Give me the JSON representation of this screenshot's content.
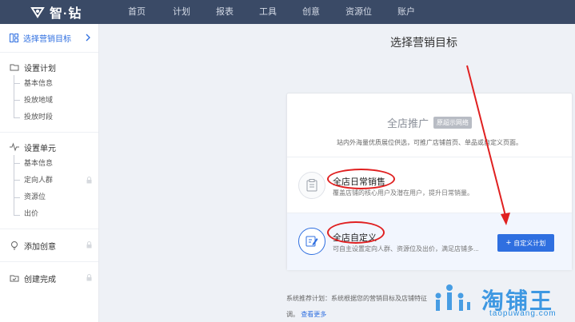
{
  "logo": {
    "text": "智·钻"
  },
  "nav": [
    "首页",
    "计划",
    "报表",
    "工具",
    "创意",
    "资源位",
    "账户"
  ],
  "sidebar": {
    "head": "选择营销目标",
    "plan": {
      "title": "设置计划",
      "items": [
        "基本信息",
        "投放地域",
        "投放时段"
      ]
    },
    "unit": {
      "title": "设置单元",
      "items": [
        "基本信息",
        "定向人群",
        "资源位",
        "出价"
      ]
    },
    "creative": "添加创意",
    "done": "创建完成"
  },
  "main": {
    "title": "选择营销目标",
    "card": {
      "head_title": "全店推广",
      "badge": "原超示网络",
      "head_desc": "站内外海量优质展位供选，可推广店铺首页、单品或自定义页面。",
      "option1": {
        "title": "全店日常销售",
        "desc": "覆盖店铺的核心用户及潜在用户，提升日常销量。"
      },
      "option2": {
        "title": "全店自定义",
        "desc": "可自主设置定向人群、资源位及出价，满足店铺多...",
        "button": "自定义计划"
      }
    },
    "recommend": {
      "text": "系统推荐计划：系统根据您的营销目标及店铺特征",
      "text2": "调。",
      "more": "查看更多"
    }
  },
  "watermark": {
    "brand": "淘铺王",
    "url": "taopuwang.com"
  },
  "colors": {
    "nav_bg": "#3a4a66",
    "accent": "#2f6fe0",
    "annotation": "#e02020"
  }
}
